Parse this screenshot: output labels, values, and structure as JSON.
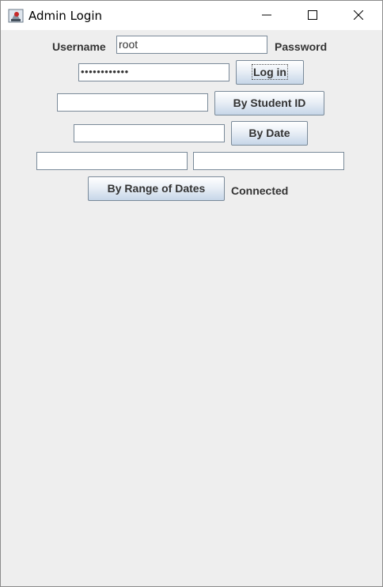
{
  "window": {
    "title": "Admin Login",
    "icon": "java-app-icon",
    "controls": [
      "minimize-icon",
      "maximize-icon",
      "close-icon"
    ]
  },
  "login": {
    "username_label": "Username",
    "username_value": "root",
    "password_label": "Password",
    "password_masked": "••••••••••••",
    "login_button": "Log in"
  },
  "search": {
    "student_id_button": "By Student ID",
    "date_button": "By Date",
    "range_button": "By Range of Dates",
    "status": "Connected"
  },
  "colors": {
    "button_gradient_top": "#ffffff",
    "button_gradient_bottom": "#c6d6e8",
    "background": "#eeeeee"
  }
}
